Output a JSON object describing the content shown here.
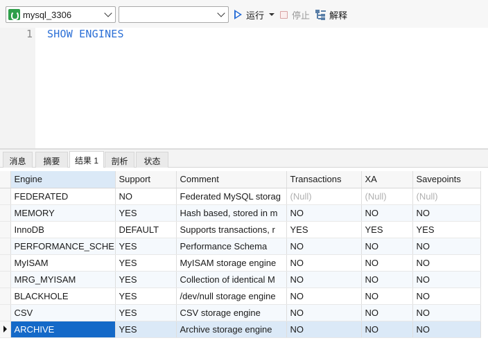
{
  "toolbar": {
    "connection": "mysql_3306",
    "database": "",
    "run_label": "运行",
    "stop_label": "停止",
    "explain_label": "解释"
  },
  "editor": {
    "line_number": "1",
    "code": "SHOW ENGINES"
  },
  "tabs": [
    "消息",
    "摘要",
    "结果 1",
    "剖析",
    "状态"
  ],
  "active_tab": "结果 1",
  "grid": {
    "columns": [
      "Engine",
      "Support",
      "Comment",
      "Transactions",
      "XA",
      "Savepoints"
    ],
    "rows": [
      [
        "FEDERATED",
        "NO",
        "Federated MySQL storag",
        "(Null)",
        "(Null)",
        "(Null)"
      ],
      [
        "MEMORY",
        "YES",
        "Hash based, stored in m",
        "NO",
        "NO",
        "NO"
      ],
      [
        "InnoDB",
        "DEFAULT",
        "Supports transactions, r",
        "YES",
        "YES",
        "YES"
      ],
      [
        "PERFORMANCE_SCHEI",
        "YES",
        "Performance Schema",
        "NO",
        "NO",
        "NO"
      ],
      [
        "MyISAM",
        "YES",
        "MyISAM storage engine",
        "NO",
        "NO",
        "NO"
      ],
      [
        "MRG_MYISAM",
        "YES",
        "Collection of identical M",
        "NO",
        "NO",
        "NO"
      ],
      [
        "BLACKHOLE",
        "YES",
        "/dev/null storage engine",
        "NO",
        "NO",
        "NO"
      ],
      [
        "CSV",
        "YES",
        "CSV storage engine",
        "NO",
        "NO",
        "NO"
      ],
      [
        "ARCHIVE",
        "YES",
        "Archive storage engine",
        "NO",
        "NO",
        "NO"
      ]
    ],
    "selected_row": 8
  },
  "icons": {
    "connection": "mysql-dolphin-icon",
    "run": "play-icon",
    "stop": "stop-icon",
    "explain": "explain-icon"
  },
  "colors": {
    "accent": "#2b6fd6",
    "selection": "#1469c8",
    "selected_row_bg": "#dbe9f7"
  }
}
